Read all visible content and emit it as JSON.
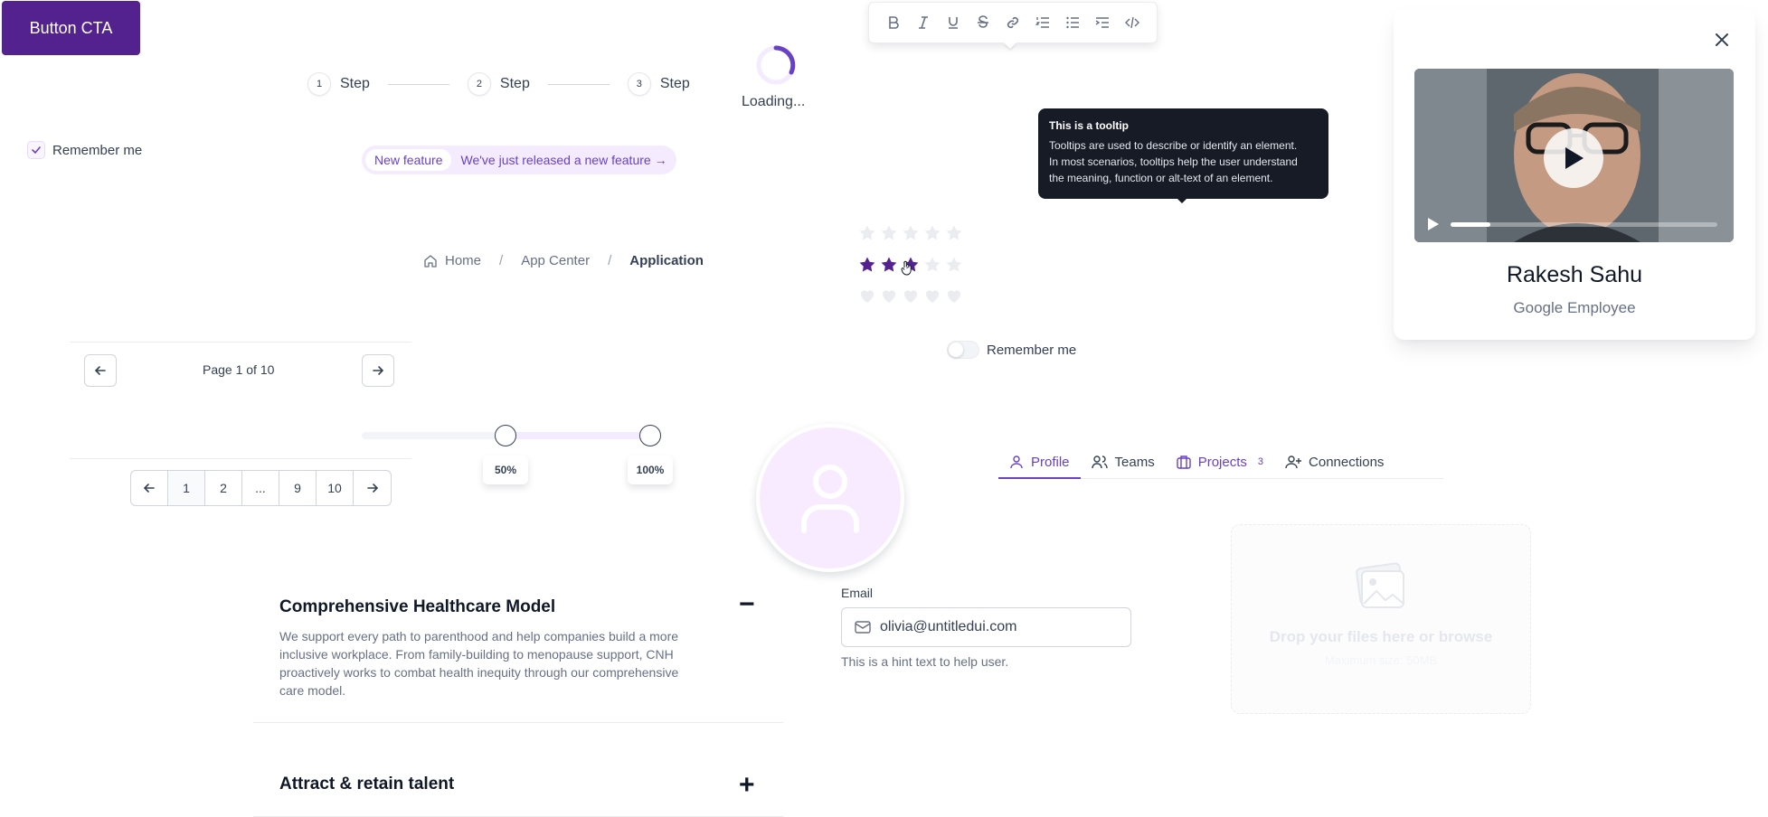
{
  "cta": {
    "label": "Button CTA"
  },
  "steps": [
    {
      "num": "1",
      "label": "Step"
    },
    {
      "num": "2",
      "label": "Step"
    },
    {
      "num": "3",
      "label": "Step"
    }
  ],
  "loading": {
    "label": "Loading..."
  },
  "toolbar": {
    "icons": [
      "bold-icon",
      "italic-icon",
      "underline-icon",
      "strikethrough-icon",
      "link-icon",
      "ordered-list-icon",
      "bullet-list-icon",
      "indent-list-icon",
      "code-icon"
    ]
  },
  "remember_checkbox": {
    "label": "Remember me",
    "checked": true
  },
  "badge": {
    "pill": "New feature",
    "text": "We've just released a new feature →"
  },
  "breadcrumb": {
    "items": [
      "Home",
      "App Center",
      "Application"
    ],
    "separator": "/"
  },
  "tooltip": {
    "title": "This is a tooltip",
    "body_lines": [
      "Tooltips are used to describe or identify an element.",
      "In most scenarios, tooltips help the user understand",
      "the meaning, function or alt-text of an element."
    ]
  },
  "ratings": [
    {
      "shape": "star",
      "value": 0,
      "max": 5
    },
    {
      "shape": "star",
      "value": 3,
      "max": 5
    },
    {
      "shape": "heart",
      "value": 0,
      "max": 5
    }
  ],
  "toggle": {
    "label": "Remember me",
    "on": false
  },
  "profile_card": {
    "name": "Rakesh Sahu",
    "role": "Google Employee",
    "video_progress": 0.15
  },
  "pagination_simple": {
    "text": "Page 1 of 10"
  },
  "pagination_numbers": {
    "pages": [
      "1",
      "2",
      "...",
      "9",
      "10"
    ],
    "active": "1"
  },
  "slider": {
    "low": "50%",
    "high": "100%",
    "low_value": 0.5,
    "high_value": 1.0
  },
  "tabs": [
    {
      "label": "Profile",
      "icon": "user-icon",
      "active": true
    },
    {
      "label": "Teams",
      "icon": "users-icon",
      "active": false
    },
    {
      "label": "Projects",
      "icon": "briefcase-icon",
      "count": "3",
      "active": false
    },
    {
      "label": "Connections",
      "icon": "user-plus-icon",
      "active": false
    }
  ],
  "email": {
    "label": "Email",
    "value": "olivia@untitledui.com",
    "hint": "This is a hint text to help user."
  },
  "dropzone": {
    "title": "Drop your files here or browse",
    "subtitle": "Maximum size: 50MB"
  },
  "accordion": [
    {
      "title": "Comprehensive Healthcare Model",
      "expanded": true,
      "toggle": "−",
      "body": "We support every path to parenthood and help companies build a more inclusive workplace. From family-building to menopause support, CNH proactively works to combat health inequity through our comprehensive care model."
    },
    {
      "title": "Attract & retain talent",
      "expanded": false,
      "toggle": "+"
    }
  ],
  "colors": {
    "primary": "#53228f",
    "accent": "#6941c6",
    "tooltip_bg": "#161b26"
  }
}
